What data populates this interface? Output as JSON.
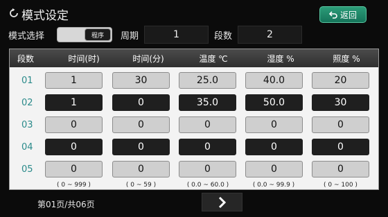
{
  "title": "模式设定",
  "back_label": "返回",
  "controls": {
    "mode_label": "模式选择",
    "mode_value": "程序",
    "period_label": "周期",
    "period_value": "1",
    "segment_label": "段数",
    "segment_value": "2"
  },
  "table": {
    "headers": [
      "段数",
      "时间(时)",
      "时间(分)",
      "温度 ℃",
      "湿度 %",
      "照度 %"
    ],
    "rows": [
      {
        "idx": "01",
        "values": [
          "1",
          "30",
          "25.0",
          "40.0",
          "20"
        ]
      },
      {
        "idx": "02",
        "values": [
          "1",
          "0",
          "35.0",
          "50.0",
          "30"
        ]
      },
      {
        "idx": "03",
        "values": [
          "0",
          "0",
          "0",
          "0",
          "0"
        ]
      },
      {
        "idx": "04",
        "values": [
          "0",
          "0",
          "0",
          "0",
          "0"
        ]
      },
      {
        "idx": "05",
        "values": [
          "0",
          "0",
          "0",
          "0",
          "0"
        ]
      }
    ],
    "ranges": [
      "( 0 ~ 999 )",
      "( 0 ~ 59 )",
      "( 0.0  ~  60.0 )",
      "( 0.0 ~ 99.9 )",
      "( 0 ~  100  )"
    ]
  },
  "pager": {
    "text": "第01页/共06页"
  }
}
